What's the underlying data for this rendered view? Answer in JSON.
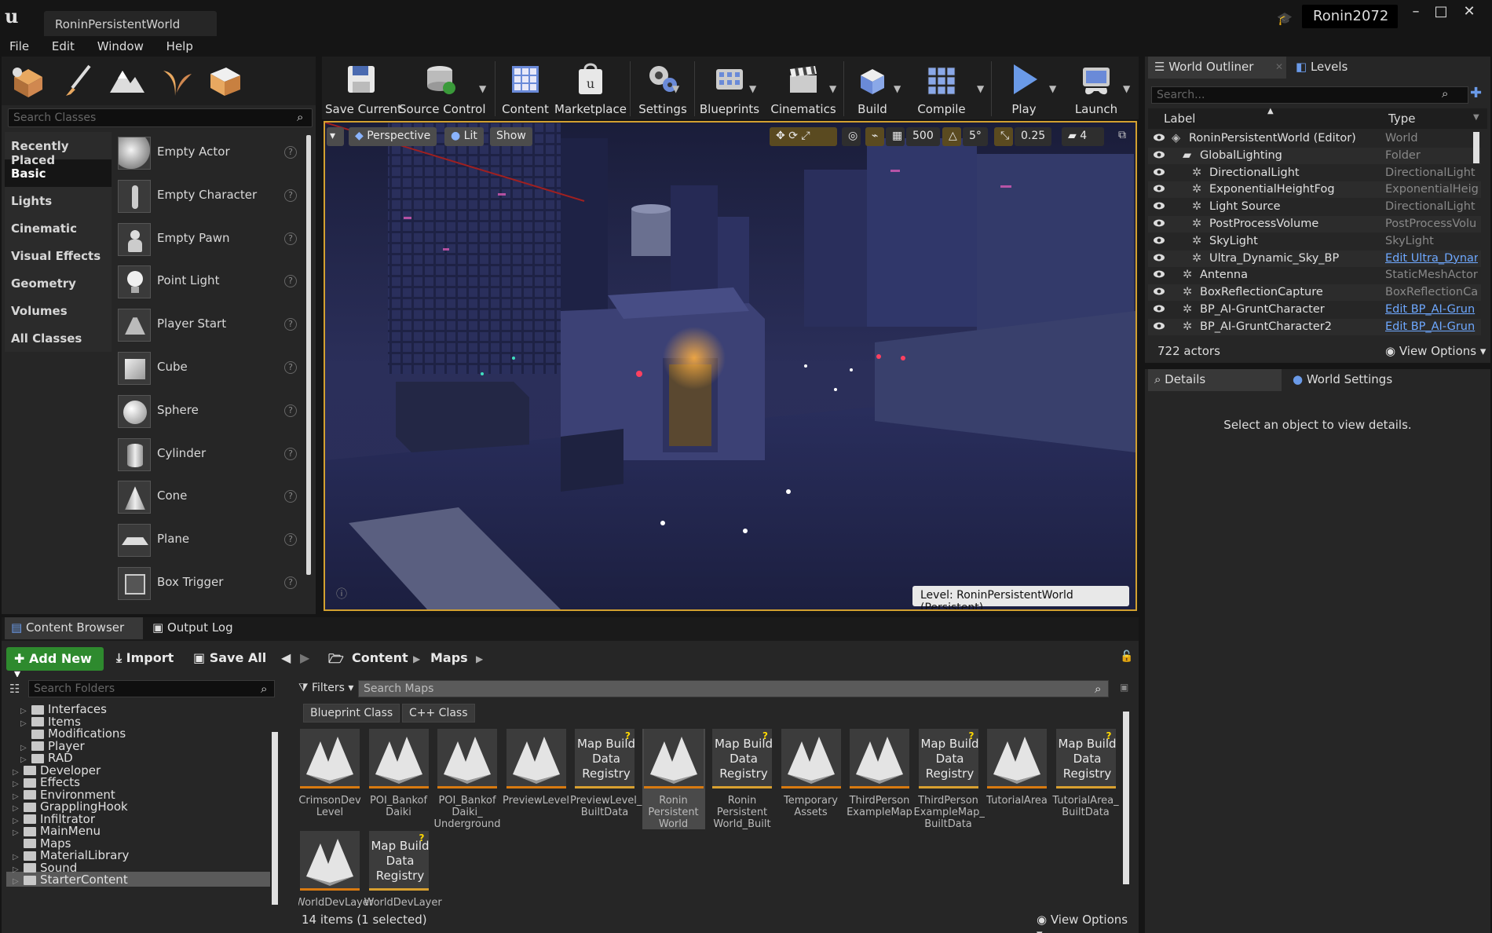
{
  "window": {
    "tab_title": "RoninPersistentWorld",
    "project_name": "Ronin2072",
    "controls": [
      "–",
      "□",
      "✕"
    ]
  },
  "menu": [
    "File",
    "Edit",
    "Window",
    "Help"
  ],
  "modes": {
    "search_placeholder": "Search Classes",
    "categories": [
      "Recently Placed",
      "Basic",
      "Lights",
      "Cinematic",
      "Visual Effects",
      "Geometry",
      "Volumes",
      "All Classes"
    ],
    "selected_category": "Basic",
    "actors": [
      "Empty Actor",
      "Empty Character",
      "Empty Pawn",
      "Point Light",
      "Player Start",
      "Cube",
      "Sphere",
      "Cylinder",
      "Cone",
      "Plane",
      "Box Trigger"
    ]
  },
  "toolbar": {
    "buttons": [
      "Save Current",
      "Source Control",
      "Content",
      "Marketplace",
      "Settings",
      "Blueprints",
      "Cinematics",
      "Build",
      "Compile",
      "Play",
      "Launch"
    ]
  },
  "viewport": {
    "perspective": "Perspective",
    "lit": "Lit",
    "show": "Show",
    "grid_snap": "500",
    "rotation_snap": "5°",
    "scale_snap": "0.25",
    "camera_speed": "4",
    "level_label": "Level:  RoninPersistentWorld (Persistent)"
  },
  "outliner": {
    "tab_outliner": "World Outliner",
    "tab_levels": "Levels",
    "search_placeholder": "Search...",
    "col_label": "Label",
    "col_type": "Type",
    "rows": [
      {
        "label": "RoninPersistentWorld (Editor)",
        "type": "World",
        "indent": 0,
        "link": false
      },
      {
        "label": "GlobalLighting",
        "type": "Folder",
        "indent": 1,
        "link": false
      },
      {
        "label": "DirectionalLight",
        "type": "DirectionalLight",
        "indent": 2,
        "link": false
      },
      {
        "label": "ExponentialHeightFog",
        "type": "ExponentialHeigh",
        "indent": 2,
        "link": false
      },
      {
        "label": "Light Source",
        "type": "DirectionalLight",
        "indent": 2,
        "link": false
      },
      {
        "label": "PostProcessVolume",
        "type": "PostProcessVolu",
        "indent": 2,
        "link": false
      },
      {
        "label": "SkyLight",
        "type": "SkyLight",
        "indent": 2,
        "link": false
      },
      {
        "label": "Ultra_Dynamic_Sky_BP",
        "type": "Edit Ultra_Dynar",
        "indent": 2,
        "link": true
      },
      {
        "label": "Antenna",
        "type": "StaticMeshActor",
        "indent": 1,
        "link": false
      },
      {
        "label": "BoxReflectionCapture",
        "type": "BoxReflectionCap",
        "indent": 1,
        "link": false
      },
      {
        "label": "BP_AI-GruntCharacter",
        "type": "Edit BP_AI-Grun",
        "indent": 1,
        "link": true
      },
      {
        "label": "BP_AI-GruntCharacter2",
        "type": "Edit BP_AI-Grun",
        "indent": 1,
        "link": true
      }
    ],
    "actor_count": "722 actors",
    "view_options": "View Options"
  },
  "details": {
    "tab_details": "Details",
    "tab_world_settings": "World Settings",
    "empty_message": "Select an object to view details."
  },
  "content_browser": {
    "tab_cb": "Content Browser",
    "tab_log": "Output Log",
    "add_new": "Add New",
    "import": "Import",
    "save_all": "Save All",
    "path": [
      "Content",
      "Maps"
    ],
    "search_folders": "Search Folders",
    "filters": "Filters",
    "search_maps": "Search Maps",
    "chips": [
      "Blueprint Class",
      "C++ Class"
    ],
    "folders": [
      {
        "name": "Interfaces",
        "indent": 1,
        "tri": true
      },
      {
        "name": "Items",
        "indent": 1,
        "tri": true
      },
      {
        "name": "Modifications",
        "indent": 1,
        "tri": false
      },
      {
        "name": "Player",
        "indent": 1,
        "tri": true
      },
      {
        "name": "RAD",
        "indent": 1,
        "tri": true
      },
      {
        "name": "Developer",
        "indent": 0,
        "tri": true
      },
      {
        "name": "Effects",
        "indent": 0,
        "tri": true
      },
      {
        "name": "Environment",
        "indent": 0,
        "tri": true
      },
      {
        "name": "GrapplingHook",
        "indent": 0,
        "tri": true
      },
      {
        "name": "Infiltrator",
        "indent": 0,
        "tri": true
      },
      {
        "name": "MainMenu",
        "indent": 0,
        "tri": true
      },
      {
        "name": "Maps",
        "indent": 0,
        "tri": false
      },
      {
        "name": "MaterialLibrary",
        "indent": 0,
        "tri": true
      },
      {
        "name": "Sound",
        "indent": 0,
        "tri": true
      },
      {
        "name": "StarterContent",
        "indent": 0,
        "tri": true
      }
    ],
    "assets": [
      {
        "name": "CrimsonDev Level",
        "kind": "map"
      },
      {
        "name": "POI_Bankof Daiki",
        "kind": "map"
      },
      {
        "name": "POI_Bankof Daiki_ Underground",
        "kind": "map"
      },
      {
        "name": "PreviewLevel",
        "kind": "map"
      },
      {
        "name": "PreviewLevel_ BuiltData",
        "kind": "reg"
      },
      {
        "name": "Ronin Persistent World",
        "kind": "map"
      },
      {
        "name": "Ronin Persistent World_Built",
        "kind": "reg"
      },
      {
        "name": "Temporary Assets",
        "kind": "map"
      },
      {
        "name": "ThirdPerson ExampleMap",
        "kind": "map"
      },
      {
        "name": "ThirdPerson ExampleMap_ BuiltData",
        "kind": "reg"
      },
      {
        "name": "TutorialArea",
        "kind": "map"
      },
      {
        "name": "TutorialArea_ BuiltData",
        "kind": "reg"
      },
      {
        "name": "WorldDevLayer",
        "kind": "map"
      },
      {
        "name": "WorldDevLayer",
        "kind": "reg"
      }
    ],
    "registry_text": "Map Build Data Registry",
    "items_count": "14 items (1 selected)",
    "view_options": "View Options"
  }
}
